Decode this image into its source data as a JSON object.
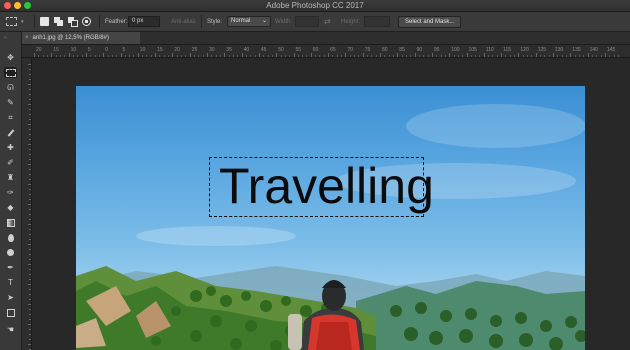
{
  "app": {
    "title": "Adobe Photoshop CC 2017"
  },
  "options_bar": {
    "feather_label": "Feather:",
    "feather_value": "0 px",
    "antialias_label": "Anti-alias",
    "style_label": "Style:",
    "style_value": "Normal",
    "width_label": "Width:",
    "height_label": "Height:",
    "select_mask_label": "Select and Mask..."
  },
  "document": {
    "tab_label": "anh1.jpg @ 12,5% (RGB/8#)"
  },
  "ruler": {
    "top_ticks": [
      "20",
      "15",
      "10",
      "5",
      "0",
      "5",
      "10",
      "15",
      "20",
      "25",
      "30",
      "35",
      "40",
      "45",
      "50",
      "55",
      "60",
      "65",
      "70",
      "75",
      "80",
      "85",
      "90",
      "95",
      "100",
      "105",
      "110",
      "115",
      "120",
      "125",
      "130",
      "135",
      "140",
      "145",
      "150"
    ]
  },
  "canvas": {
    "headline": "Travelling"
  },
  "colors": {
    "accent": "#3a8fd3",
    "panel": "#393939",
    "background": "#262626"
  },
  "tools": [
    "move-icon",
    "marquee-icon",
    "lasso-icon",
    "quick-select-icon",
    "crop-icon",
    "eyedropper-icon",
    "healing-icon",
    "brush-icon",
    "stamp-icon",
    "history-brush-icon",
    "eraser-icon",
    "gradient-icon",
    "blur-icon",
    "dodge-icon",
    "pen-icon",
    "type-icon",
    "path-select-icon",
    "rectangle-icon"
  ]
}
